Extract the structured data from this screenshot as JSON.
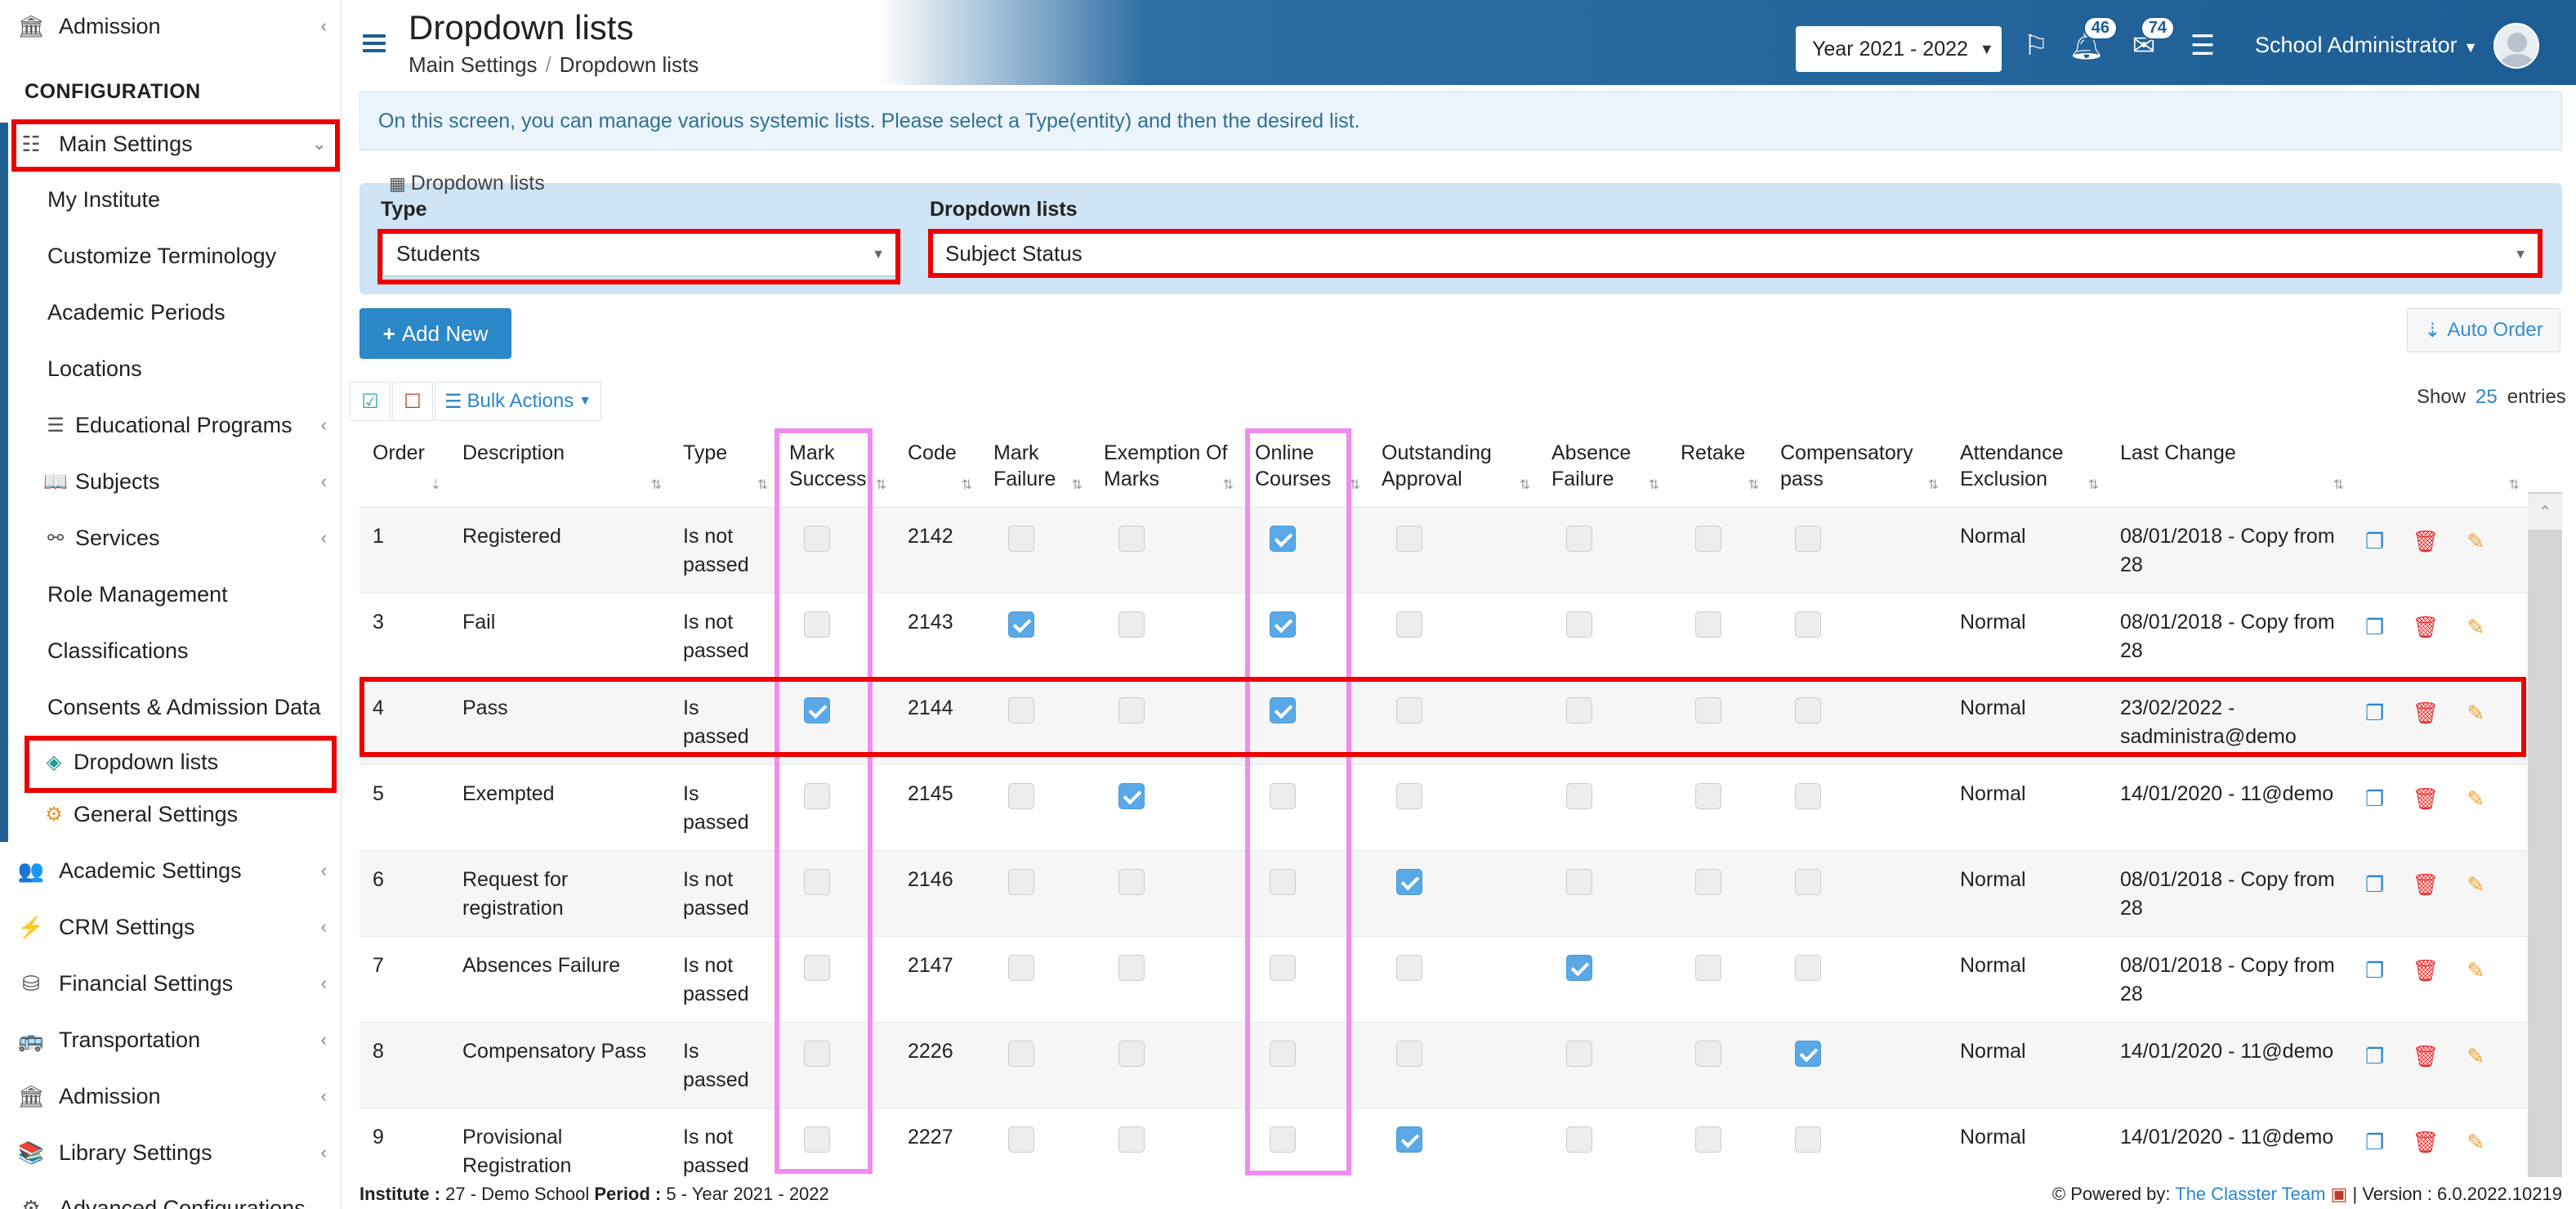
{
  "sidebar": {
    "top_item": "Admission",
    "section_header": "CONFIGURATION",
    "main_settings": "Main Settings",
    "sub_items": [
      {
        "label": "My Institute"
      },
      {
        "label": "Customize Terminology"
      },
      {
        "label": "Academic Periods"
      },
      {
        "label": "Locations"
      },
      {
        "label": "Educational Programs"
      },
      {
        "label": "Subjects"
      },
      {
        "label": "Services"
      },
      {
        "label": "Role Management"
      },
      {
        "label": "Classifications"
      },
      {
        "label": "Consents & Admission Data"
      },
      {
        "label": "Dropdown lists"
      },
      {
        "label": "General Settings"
      }
    ],
    "bottom_items": [
      {
        "label": "Academic Settings"
      },
      {
        "label": "CRM Settings"
      },
      {
        "label": "Financial Settings"
      },
      {
        "label": "Transportation"
      },
      {
        "label": "Admission"
      },
      {
        "label": "Library Settings"
      },
      {
        "label": "Advanced Configurations"
      }
    ]
  },
  "header": {
    "title": "Dropdown lists",
    "breadcrumb_1": "Main Settings",
    "breadcrumb_sep": "/",
    "breadcrumb_2": "Dropdown lists",
    "year": "Year 2021 - 2022",
    "notifications_count": "46",
    "messages_count": "74",
    "user": "School Administrator"
  },
  "info_text": "On this screen, you can manage various systemic lists. Please select a Type(entity) and then the desired list.",
  "panel": {
    "title": "Dropdown lists",
    "type_label": "Type",
    "type_value": "Students",
    "list_label": "Dropdown lists",
    "list_value": "Subject Status"
  },
  "buttons": {
    "add_new": "Add New",
    "auto_order": "Auto Order",
    "bulk_actions": "Bulk Actions"
  },
  "show_entries": {
    "prefix": "Show",
    "value": "25",
    "suffix": "entries"
  },
  "table": {
    "headers": [
      "Order",
      "Description",
      "Type",
      "Mark Success",
      "Code",
      "Mark Failure",
      "Exemption Of Marks",
      "Online Courses",
      "Outstanding Approval",
      "Absence Failure",
      "Retake",
      "Compensatory pass",
      "Attendance Exclusion",
      "Last Change"
    ],
    "rows": [
      {
        "order": "1",
        "description": "Registered",
        "type": "Is not passed",
        "code": "2142",
        "mark_success": false,
        "mark_failure": false,
        "exemption": false,
        "online": true,
        "outstanding": false,
        "absence": false,
        "retake": false,
        "compensatory": false,
        "attendance": "Normal",
        "last_change": "08/01/2018 - Copy from 28"
      },
      {
        "order": "3",
        "description": "Fail",
        "type": "Is not passed",
        "code": "2143",
        "mark_success": false,
        "mark_failure": true,
        "exemption": false,
        "online": true,
        "outstanding": false,
        "absence": false,
        "retake": false,
        "compensatory": false,
        "attendance": "Normal",
        "last_change": "08/01/2018 - Copy from 28"
      },
      {
        "order": "4",
        "description": "Pass",
        "type": "Is passed",
        "code": "2144",
        "mark_success": true,
        "mark_failure": false,
        "exemption": false,
        "online": true,
        "outstanding": false,
        "absence": false,
        "retake": false,
        "compensatory": false,
        "attendance": "Normal",
        "last_change": "23/02/2022 - sadministra@demo"
      },
      {
        "order": "5",
        "description": "Exempted",
        "type": "Is passed",
        "code": "2145",
        "mark_success": false,
        "mark_failure": false,
        "exemption": true,
        "online": false,
        "outstanding": false,
        "absence": false,
        "retake": false,
        "compensatory": false,
        "attendance": "Normal",
        "last_change": "14/01/2020 - 11@demo"
      },
      {
        "order": "6",
        "description": "Request for registration",
        "type": "Is not passed",
        "code": "2146",
        "mark_success": false,
        "mark_failure": false,
        "exemption": false,
        "online": false,
        "outstanding": true,
        "absence": false,
        "retake": false,
        "compensatory": false,
        "attendance": "Normal",
        "last_change": "08/01/2018 - Copy from 28"
      },
      {
        "order": "7",
        "description": "Absences Failure",
        "type": "Is not passed",
        "code": "2147",
        "mark_success": false,
        "mark_failure": false,
        "exemption": false,
        "online": false,
        "outstanding": false,
        "absence": true,
        "retake": false,
        "compensatory": false,
        "attendance": "Normal",
        "last_change": "08/01/2018 - Copy from 28"
      },
      {
        "order": "8",
        "description": "Compensatory Pass",
        "type": "Is passed",
        "code": "2226",
        "mark_success": false,
        "mark_failure": false,
        "exemption": false,
        "online": false,
        "outstanding": false,
        "absence": false,
        "retake": false,
        "compensatory": true,
        "attendance": "Normal",
        "last_change": "14/01/2020 - 11@demo"
      },
      {
        "order": "9",
        "description": "Provisional Registration",
        "type": "Is not passed",
        "code": "2227",
        "mark_success": false,
        "mark_failure": false,
        "exemption": false,
        "online": false,
        "outstanding": true,
        "absence": false,
        "retake": false,
        "compensatory": false,
        "attendance": "Normal",
        "last_change": "14/01/2020 - 11@demo"
      }
    ]
  },
  "footer": {
    "institute_label": "Institute :",
    "institute_value": "27 - Demo School",
    "period_label": "Period :",
    "period_value": "5 - Year 2021 - 2022",
    "powered_by": "Powered by:",
    "powered_link": "The Classter Team",
    "version": "| Version : 6.0.2022.10219"
  },
  "colors": {
    "header_blue": "#1d5d94",
    "accent": "#2a87c8",
    "highlight_red": "#ee0000",
    "highlight_pink": "#f08cf0"
  }
}
